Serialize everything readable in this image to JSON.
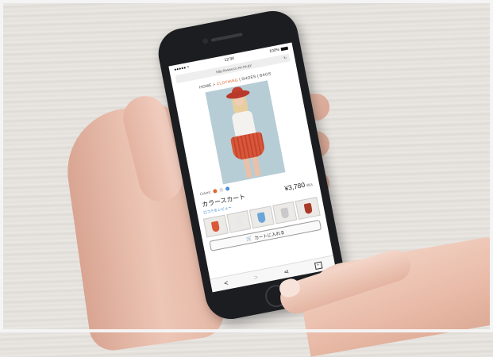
{
  "status_bar": {
    "carrier": "●●●●● ≈",
    "time": "12:34",
    "battery": "100%"
  },
  "browser": {
    "url": "http://www.co.ne.ne.jp/",
    "reload_icon": "reload-icon"
  },
  "breadcrumb": {
    "home": "HOME",
    "sep1": " > ",
    "category": "CLOTHING",
    "sep2": " | ",
    "shoes": "SHOES",
    "sep3": " | ",
    "bags": "BAGS"
  },
  "product": {
    "colors_label": "Colors:",
    "swatch_colors": [
      "#e2652c",
      "#dddddd",
      "#4a90d9"
    ],
    "name": "カラースカート",
    "price": "¥3,780",
    "tax_note": "税込",
    "review_link": "口コミをレビュー",
    "thumbnail_colors": [
      "#d9573a",
      "#e8e8e8",
      "#6aa6d8",
      "#c9c9c9",
      "#a83a2a"
    ],
    "add_to_cart": "カートに入れる"
  },
  "toolbar": {
    "back": "<",
    "forward": ">"
  }
}
